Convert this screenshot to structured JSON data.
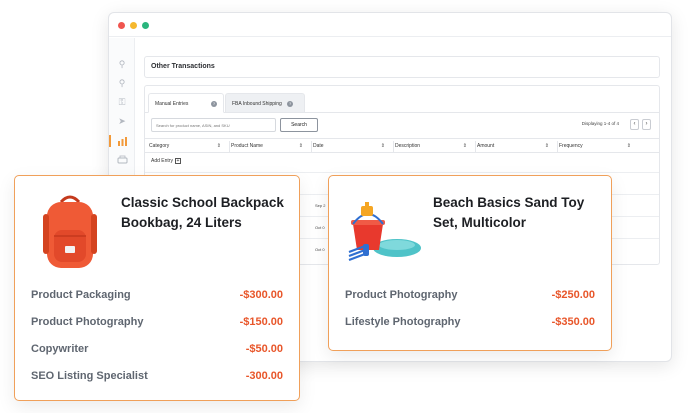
{
  "window": {
    "section_title": "Other Transactions",
    "tabs": [
      {
        "label": "Manual Entries"
      },
      {
        "label": "FBA Inbound Shipping"
      }
    ],
    "search": {
      "placeholder": "Search for product name, ASIN, and SKU",
      "button_label": "Search"
    },
    "pagination": {
      "displaying": "Displaying  1-4  of 4",
      "prev": "‹",
      "next": "›"
    },
    "table": {
      "columns": [
        "Category",
        "Product Name",
        "Date",
        "Description",
        "Amount",
        "Frequency"
      ],
      "sort_glyph": "⇕",
      "add_entry_label": "Add Entry",
      "visible_dates": [
        "Sep 2",
        "Oct 0",
        "Oct 0"
      ]
    },
    "sidebar_icons": [
      "search-icon",
      "tag-icon",
      "key-icon",
      "send-icon",
      "chart-icon",
      "printer-icon"
    ]
  },
  "cards": [
    {
      "title": "Classic School Backpack Bookbag, 24 Liters",
      "product_icon": "backpack-image",
      "services": [
        {
          "name": "Product Packaging",
          "cost": "-$300.00"
        },
        {
          "name": "Product Photography",
          "cost": "-$150.00"
        },
        {
          "name": "Copywriter",
          "cost": "-$50.00"
        },
        {
          "name": "SEO Listing Specialist",
          "cost": "-300.00"
        }
      ]
    },
    {
      "title": "Beach Basics Sand Toy Set, Multicolor",
      "product_icon": "sand-toy-image",
      "services": [
        {
          "name": "Product Photography",
          "cost": "-$250.00"
        },
        {
          "name": "Lifestyle Photography",
          "cost": "-$350.00"
        }
      ]
    }
  ],
  "colors": {
    "accent_border": "#f0a05a",
    "cost_text": "#e8562a",
    "active_sidebar": "#f29a3a"
  }
}
